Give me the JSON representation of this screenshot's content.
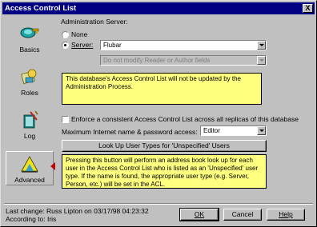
{
  "window": {
    "title": "Access Control List",
    "close_glyph": "X"
  },
  "sidebar": {
    "items": [
      {
        "label": "Basics",
        "icon": "key-icon"
      },
      {
        "label": "Roles",
        "icon": "roles-icon"
      },
      {
        "label": "Log",
        "icon": "log-book-icon"
      },
      {
        "label": "Advanced",
        "icon": "advanced-icon",
        "selected": true
      }
    ],
    "selected_marker_color": "#c00000"
  },
  "admin_server": {
    "heading": "Administration Server:",
    "option_none": "None",
    "option_server": "Server:",
    "selected": "server",
    "server_value": "Flubar",
    "fields_value": "Do not modify Reader or Author fields"
  },
  "note1": "This database's Access Control List will not be updated by the Administration Process.",
  "enforce": {
    "label": "Enforce a consistent Access Control List across all replicas of this database",
    "checked": false
  },
  "max_access": {
    "label": "Maximum Internet name & password access:",
    "value": "Editor"
  },
  "lookup_button": "Look Up User Types for 'Unspecified' Users",
  "note2": "Pressing this button will perform an address book look up for each user in the Access Control List who is listed as an 'Unspecified' user type.  If the name is found, the appropriate user type (e.g. Server, Person, etc.) will be set in the ACL.",
  "footer": {
    "last_change": "Last change: Russ Lipton on 03/17/98 04:23:32",
    "according_to": "According to: Iris",
    "ok": "OK",
    "cancel": "Cancel",
    "help": "Help"
  },
  "colors": {
    "title_bar": "#000080",
    "note_bg": "#ffff80",
    "face": "#c0c0c0"
  }
}
